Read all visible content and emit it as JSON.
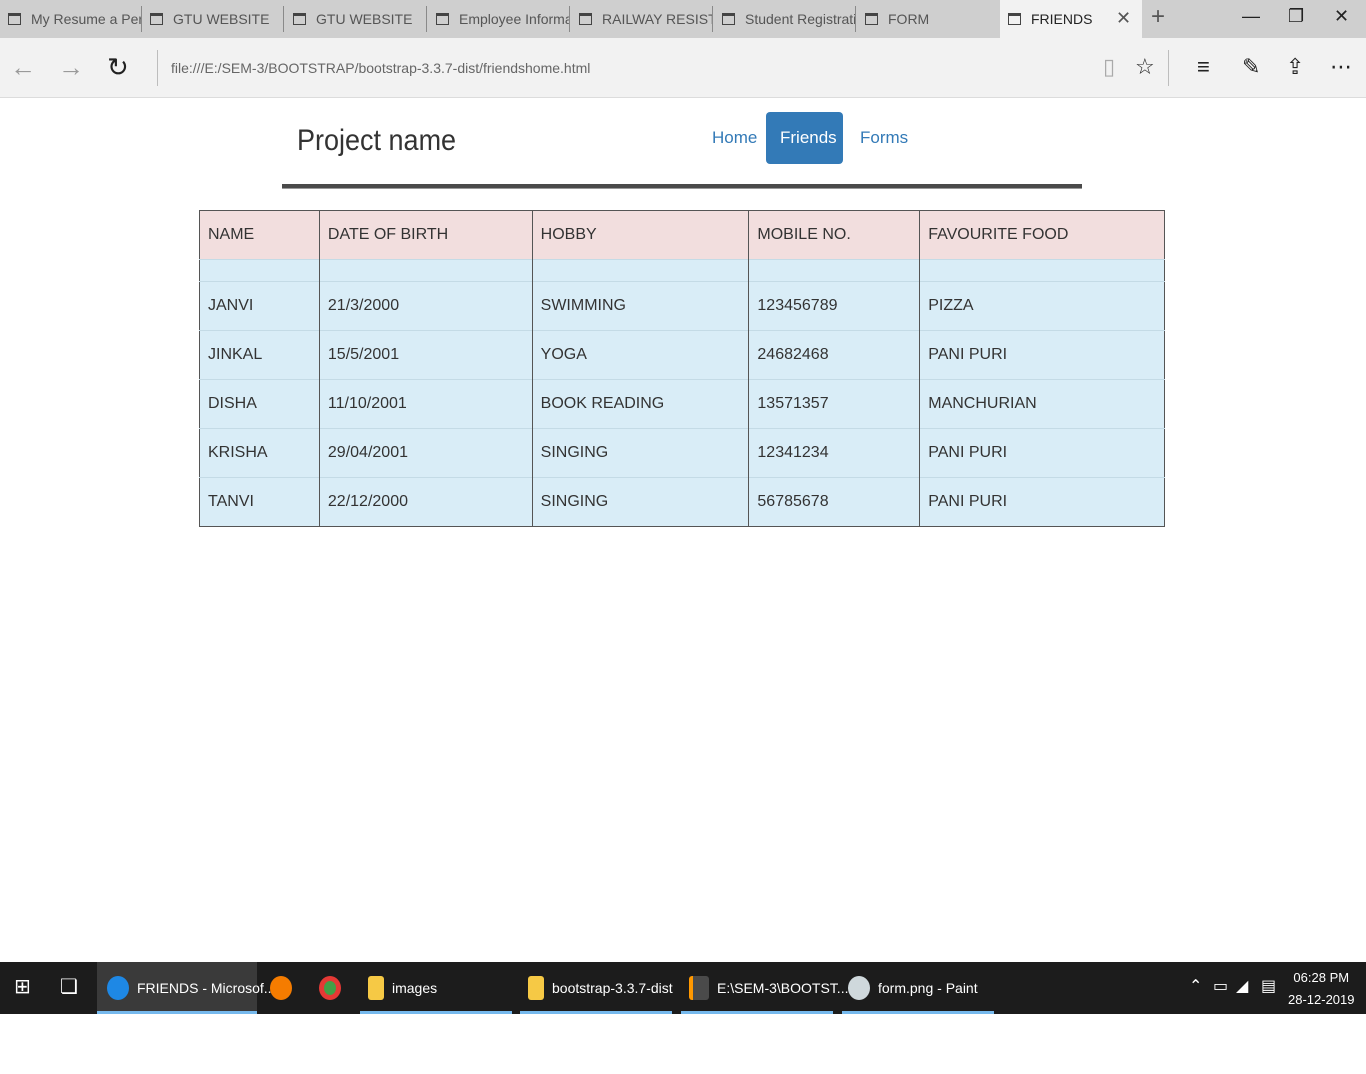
{
  "browser": {
    "tabs": [
      {
        "label": "My Resume a Pers"
      },
      {
        "label": "GTU WEBSITE"
      },
      {
        "label": "GTU WEBSITE"
      },
      {
        "label": "Employee Informa"
      },
      {
        "label": "RAILWAY RESISTR/"
      },
      {
        "label": "Student Registratic"
      },
      {
        "label": "FORM"
      },
      {
        "label": "FRIENDS",
        "active": true
      }
    ],
    "url": "file:///E:/SEM-3/BOOTSTRAP/bootstrap-3.3.7-dist/friendshome.html",
    "icons": [
      "back-icon",
      "forward-icon",
      "refresh-icon",
      "reading-view-icon",
      "favorite-star-icon",
      "hub-icon",
      "web-note-icon",
      "share-icon",
      "more-icon"
    ]
  },
  "page": {
    "brand": "Project name",
    "nav": [
      {
        "label": "Home"
      },
      {
        "label": "Friends",
        "active": true
      },
      {
        "label": "Forms"
      }
    ],
    "table": {
      "headers": [
        "NAME",
        "DATE OF BIRTH",
        "HOBBY",
        "MOBILE NO.",
        "FAVOURITE FOOD"
      ],
      "rows": [
        [
          "JANVI",
          "21/3/2000",
          "SWIMMING",
          "123456789",
          "PIZZA"
        ],
        [
          "JINKAL",
          "15/5/2001",
          "YOGA",
          "24682468",
          "PANI PURI"
        ],
        [
          "DISHA",
          "11/10/2001",
          "BOOK READING",
          "13571357",
          "MANCHURIAN"
        ],
        [
          "KRISHA",
          "29/04/2001",
          "SINGING",
          "12341234",
          "PANI PURI"
        ],
        [
          "TANVI",
          "22/12/2000",
          "SINGING",
          "56785678",
          "PANI PURI"
        ]
      ]
    },
    "colors": {
      "header_row": "#f2dede",
      "body_row": "#d9edf7",
      "nav_active": "#337ab7"
    }
  },
  "taskbar": {
    "items": [
      {
        "label": "FRIENDS - Microsof..."
      },
      {
        "label": "images"
      },
      {
        "label": "bootstrap-3.3.7-dist"
      },
      {
        "label": "E:\\SEM-3\\BOOTST..."
      },
      {
        "label": "form.png - Paint"
      }
    ],
    "time": "06:28 PM",
    "date": "28-12-2019"
  }
}
